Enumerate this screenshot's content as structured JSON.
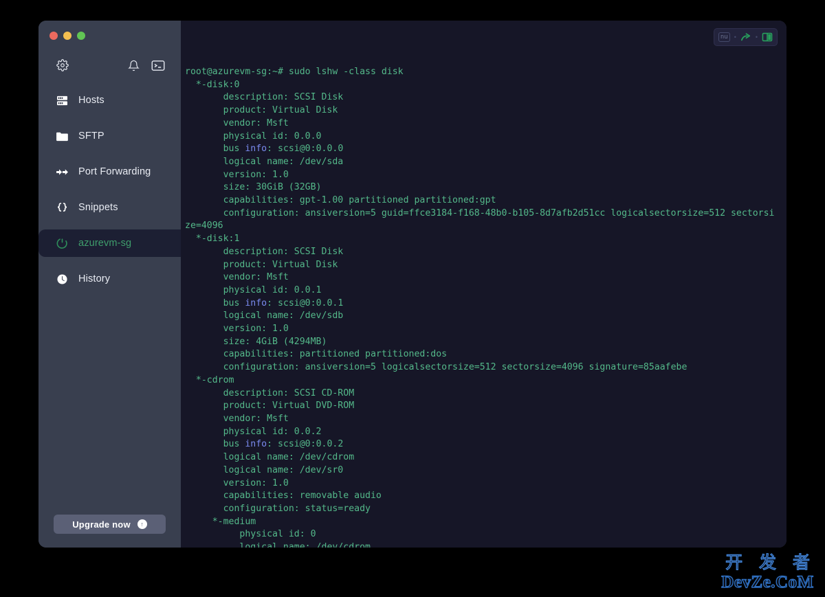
{
  "window": {
    "traffic_lights": [
      {
        "name": "close",
        "color": "#ed6a5f"
      },
      {
        "name": "minimize",
        "color": "#f4bf50"
      },
      {
        "name": "maximize",
        "color": "#61c554"
      }
    ]
  },
  "sidebar": {
    "toolbar": [
      {
        "name": "settings-icon",
        "icon": "gear-icon"
      },
      {
        "name": "notifications-icon",
        "icon": "bell-icon"
      },
      {
        "name": "new-terminal-icon",
        "icon": "terminal-icon"
      }
    ],
    "items": [
      {
        "label": "Hosts",
        "icon": "server-icon",
        "active": false
      },
      {
        "label": "SFTP",
        "icon": "folder-icon",
        "active": false
      },
      {
        "label": "Port Forwarding",
        "icon": "arrows-icon",
        "active": false
      },
      {
        "label": "Snippets",
        "icon": "braces-icon",
        "active": false
      },
      {
        "label": "azurevm-sg",
        "icon": "session-icon",
        "active": true
      },
      {
        "label": "History",
        "icon": "clock-icon",
        "active": false
      }
    ],
    "upgrade": {
      "label": "Upgrade now",
      "badge": "↑"
    },
    "colors": {
      "background": "#393f4f",
      "active_background": "#1c1f33",
      "active_text": "#3f9e6c"
    }
  },
  "terminal": {
    "controls": {
      "badge": "nu",
      "separator": "•",
      "share_icon": "share-arrow-icon",
      "split_icon": "split-pane-icon"
    },
    "colors": {
      "background": "#161627",
      "text": "#54b98a",
      "accent_blue": "#7a8bf0",
      "accent_green": "#27a05c"
    },
    "prompt": "root@azurevm-sg:~#",
    "command": "sudo lshw -class disk",
    "lines": [
      [
        {
          "t": "root@azurevm-sg:~# sudo lshw -class disk"
        }
      ],
      [
        {
          "t": "  *-disk:0"
        }
      ],
      [
        {
          "t": "       description: SCSI Disk"
        }
      ],
      [
        {
          "t": "       product: Virtual Disk"
        }
      ],
      [
        {
          "t": "       vendor: Msft"
        }
      ],
      [
        {
          "t": "       physical id: 0.0.0"
        }
      ],
      [
        {
          "t": "       bus "
        },
        {
          "t": "info",
          "c": "blue"
        },
        {
          "t": ": scsi@0:0.0.0"
        }
      ],
      [
        {
          "t": "       logical name: /dev/sda"
        }
      ],
      [
        {
          "t": "       version: 1.0"
        }
      ],
      [
        {
          "t": "       size: 30GiB (32GB)"
        }
      ],
      [
        {
          "t": "       capabilities: gpt-1.00 partitioned partitioned:gpt"
        }
      ],
      [
        {
          "t": "       configuration: ansiversion=5 guid=ffce3184-f168-48b0-b105-8d7afb2d51cc logicalsectorsize=512 sectorsize=4096"
        }
      ],
      [
        {
          "t": "  *-disk:1"
        }
      ],
      [
        {
          "t": "       description: SCSI Disk"
        }
      ],
      [
        {
          "t": "       product: Virtual Disk"
        }
      ],
      [
        {
          "t": "       vendor: Msft"
        }
      ],
      [
        {
          "t": "       physical id: 0.0.1"
        }
      ],
      [
        {
          "t": "       bus "
        },
        {
          "t": "info",
          "c": "blue"
        },
        {
          "t": ": scsi@0:0.0.1"
        }
      ],
      [
        {
          "t": "       logical name: /dev/sdb"
        }
      ],
      [
        {
          "t": "       version: 1.0"
        }
      ],
      [
        {
          "t": "       size: 4GiB (4294MB)"
        }
      ],
      [
        {
          "t": "       capabilities: partitioned partitioned:dos"
        }
      ],
      [
        {
          "t": "       configuration: ansiversion=5 logicalsectorsize=512 sectorsize=4096 signature=85aafebe"
        }
      ],
      [
        {
          "t": "  *-cdrom"
        }
      ],
      [
        {
          "t": "       description: SCSI CD-ROM"
        }
      ],
      [
        {
          "t": "       product: Virtual DVD-ROM"
        }
      ],
      [
        {
          "t": "       vendor: Msft"
        }
      ],
      [
        {
          "t": "       physical id: 0.0.2"
        }
      ],
      [
        {
          "t": "       bus "
        },
        {
          "t": "info",
          "c": "blue"
        },
        {
          "t": ": scsi@0:0.0.2"
        }
      ],
      [
        {
          "t": "       logical name: /dev/cdrom"
        }
      ],
      [
        {
          "t": "       logical name: /dev/sr0"
        }
      ],
      [
        {
          "t": "       version: 1.0"
        }
      ],
      [
        {
          "t": "       capabilities: removable audio"
        }
      ],
      [
        {
          "t": "       configuration: status=ready"
        }
      ],
      [
        {
          "t": "     *-medium"
        }
      ],
      [
        {
          "t": "          physical id: 0"
        }
      ],
      [
        {
          "t": "          logical name: /dev/cdrom"
        }
      ]
    ]
  },
  "watermark": {
    "cn": "开 发 者",
    "en": "DevZe.CoM"
  }
}
